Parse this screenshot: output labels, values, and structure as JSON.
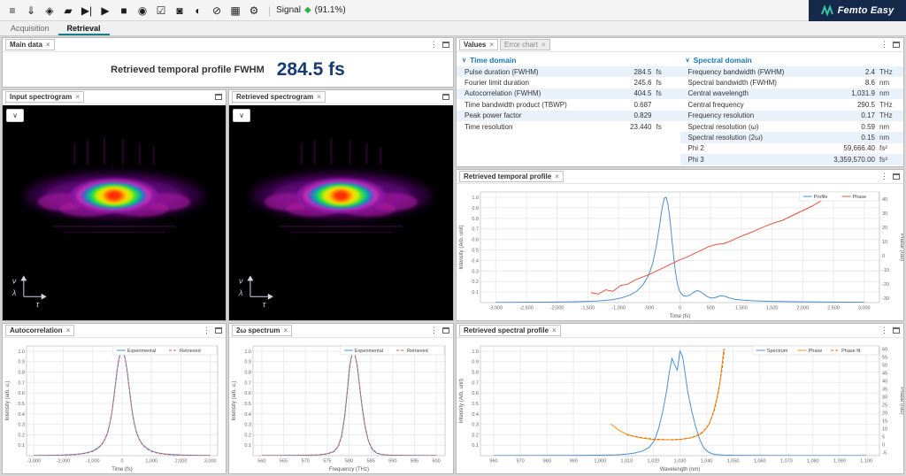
{
  "colors": {
    "accent": "#1779ba",
    "active_tab_underline": "#0f7f8b",
    "big_value": "#173b72",
    "signal_ok": "#2fb344",
    "logo_bg": "#15294b",
    "profile_blue": "#4a90d2",
    "phase_red": "#e2543f",
    "phase_orange": "#ff8c1a"
  },
  "toolbar": {
    "icons": [
      {
        "name": "menu-icon",
        "glyph": "≡"
      },
      {
        "name": "save-icon",
        "glyph": "⇓"
      },
      {
        "name": "tag-icon",
        "glyph": "◈"
      },
      {
        "name": "eraser-icon",
        "glyph": "▰"
      },
      {
        "name": "skip-end-icon",
        "glyph": "▶|"
      },
      {
        "name": "play-icon",
        "glyph": "▶"
      },
      {
        "name": "stop-icon",
        "glyph": "■"
      },
      {
        "name": "camera-icon",
        "glyph": "◉"
      },
      {
        "name": "thumbs-up-icon",
        "glyph": "☑"
      },
      {
        "name": "video-icon",
        "glyph": "◙"
      },
      {
        "name": "contrast-icon",
        "glyph": "◐"
      },
      {
        "name": "cancel-icon",
        "glyph": "⊘"
      },
      {
        "name": "grid-icon",
        "glyph": "▦"
      },
      {
        "name": "settings-icon",
        "glyph": "⚙"
      }
    ],
    "signal_label": "Signal",
    "signal_value": "(91.1%)",
    "logo_title": "Femto Easy"
  },
  "tabs": [
    {
      "label": "Acquisition",
      "active": false
    },
    {
      "label": "Retrieval",
      "active": true
    }
  ],
  "panels": {
    "main_data": {
      "tab": "Main data",
      "label": "Retrieved temporal profile FWHM",
      "value": "284.5 fs"
    },
    "values": {
      "tabs": [
        {
          "label": "Values"
        },
        {
          "label": "Error chart"
        }
      ]
    },
    "input_spectrogram": {
      "tab": "Input spectrogram"
    },
    "retrieved_spectrogram": {
      "tab": "Retrieved spectrogram"
    },
    "temporal_profile": {
      "tab": "Retrieved temporal profile"
    },
    "autocorrelation": {
      "tab": "Autocorrelation"
    },
    "spectrum_2w": {
      "tab": "2ω spectrum"
    },
    "spectral_profile": {
      "tab": "Retrieved spectral profile"
    }
  },
  "values_panel": {
    "sections": [
      {
        "title": "Time domain",
        "rows": [
          [
            "Pulse duration (FWHM)",
            "284.5",
            "fs"
          ],
          [
            "Fourier limit duration",
            "245.6",
            "fs"
          ],
          [
            "Autocorrelation (FWHM)",
            "404.5",
            "fs"
          ],
          [
            "Time bandwidth product (TBWP)",
            "0.687",
            ""
          ],
          [
            "Peak power factor",
            "0.829",
            ""
          ],
          [
            "Time resolution",
            "23.440",
            "fs"
          ]
        ]
      },
      {
        "title": "Spectral domain",
        "rows": [
          [
            "Frequency bandwidth (FWHM)",
            "2.4",
            "THz"
          ],
          [
            "Spectral bandwidth (FWHM)",
            "8.6",
            "nm"
          ],
          [
            "Central wavelength",
            "1,031.9",
            "nm"
          ],
          [
            "Central frequency",
            "290.5",
            "THz"
          ],
          [
            "Frequency resolution",
            "0.17",
            "THz"
          ],
          [
            "Spectral resolution (ω)",
            "0.59",
            "nm"
          ],
          [
            "Spectral resolution (2ω)",
            "0.15",
            "nm"
          ],
          [
            "Phi 2",
            "59,666.40",
            "fs²"
          ],
          [
            "Phi 3",
            "3,359,570.00",
            "fs³"
          ]
        ]
      }
    ]
  },
  "chart_data": {
    "temporal": {
      "type": "line",
      "xlabel": "Time (fs)",
      "ylabel": "Intensity (Arb. unit)",
      "y2label": "Phase (rad)",
      "xlim": [
        -3250,
        3250
      ],
      "ylim": [
        0,
        1.05
      ],
      "y2lim": [
        -33,
        45
      ],
      "ydec": 1,
      "xticks": [
        -3000,
        -2500,
        -2000,
        -1500,
        -1000,
        -500,
        0,
        500,
        1000,
        1500,
        2000,
        2500,
        3000
      ],
      "yticks": [
        0.1,
        0.2,
        0.3,
        0.4,
        0.5,
        0.6,
        0.7,
        0.8,
        0.9,
        1.0
      ],
      "y2ticks": [
        -30,
        -20,
        -10,
        0,
        10,
        20,
        30,
        40
      ],
      "series": [
        {
          "name": "Profile",
          "color": "#4a90d2",
          "axis": "left",
          "x": [
            -3000,
            -2200,
            -1700,
            -1350,
            -1100,
            -950,
            -820,
            -700,
            -600,
            -510,
            -440,
            -380,
            -330,
            -290,
            -255,
            -225,
            -195,
            -165,
            -135,
            -105,
            -75,
            -45,
            -15,
            20,
            60,
            110,
            170,
            230,
            280,
            330,
            390,
            450,
            520,
            590,
            660,
            730,
            800,
            900,
            1050,
            1250,
            1500,
            1900,
            2400,
            3000
          ],
          "y": [
            0.002,
            0.004,
            0.008,
            0.015,
            0.028,
            0.045,
            0.07,
            0.11,
            0.17,
            0.26,
            0.38,
            0.55,
            0.74,
            0.9,
            0.99,
            1.0,
            0.93,
            0.8,
            0.63,
            0.45,
            0.3,
            0.19,
            0.12,
            0.085,
            0.065,
            0.06,
            0.075,
            0.1,
            0.115,
            0.105,
            0.08,
            0.055,
            0.042,
            0.05,
            0.065,
            0.06,
            0.045,
            0.03,
            0.022,
            0.016,
            0.012,
            0.008,
            0.005,
            0.003
          ]
        },
        {
          "name": "Phase",
          "color": "#e2543f",
          "axis": "right",
          "x": [
            -1450,
            -1330,
            -1210,
            -1090,
            -970,
            -850,
            -730,
            -610,
            -490,
            -370,
            -250,
            -130,
            -10,
            110,
            230,
            350,
            470,
            590,
            710,
            830,
            950,
            1070,
            1190,
            1310,
            1430,
            1550,
            1670,
            1790,
            1910,
            2030,
            2150,
            2270,
            2350
          ],
          "y": [
            -26,
            -27,
            -24,
            -25,
            -21,
            -20,
            -17,
            -15,
            -13,
            -10.5,
            -8,
            -5.5,
            -3,
            -1,
            1.5,
            4,
            6.5,
            8,
            8.5,
            10.5,
            13,
            15,
            17,
            19.5,
            21.5,
            23.5,
            25,
            27.5,
            30,
            32.5,
            35,
            38,
            40
          ]
        }
      ]
    },
    "autocorrelation": {
      "type": "line",
      "xlabel": "Time (fs)",
      "ylabel": "Intensity (arb. u.)",
      "xlim": [
        -3250,
        3250
      ],
      "ylim": [
        0,
        1.05
      ],
      "ydec": 1,
      "xticks": [
        -3000,
        -2000,
        -1000,
        0,
        1000,
        2000,
        3000
      ],
      "yticks": [
        0.1,
        0.2,
        0.3,
        0.4,
        0.5,
        0.6,
        0.7,
        0.8,
        0.9,
        1.0
      ],
      "series": [
        {
          "name": "Experimental",
          "color": "#4a90d2",
          "axis": "left",
          "x": [
            -3000,
            -2500,
            -2000,
            -1700,
            -1400,
            -1200,
            -1000,
            -850,
            -700,
            -600,
            -500,
            -420,
            -350,
            -290,
            -230,
            -170,
            -110,
            -60,
            0,
            60,
            110,
            170,
            230,
            290,
            350,
            420,
            500,
            600,
            700,
            850,
            1000,
            1200,
            1400,
            1700,
            2000,
            2500,
            3000
          ],
          "y": [
            0.002,
            0.003,
            0.006,
            0.01,
            0.018,
            0.028,
            0.045,
            0.07,
            0.105,
            0.15,
            0.215,
            0.3,
            0.41,
            0.54,
            0.68,
            0.82,
            0.92,
            0.98,
            1.0,
            0.98,
            0.92,
            0.82,
            0.68,
            0.54,
            0.41,
            0.3,
            0.215,
            0.15,
            0.105,
            0.07,
            0.045,
            0.028,
            0.018,
            0.01,
            0.006,
            0.003,
            0.002
          ]
        },
        {
          "name": "Retrieved",
          "color": "#d9534f",
          "axis": "left",
          "dash": true,
          "x": [
            -3000,
            -2500,
            -2000,
            -1700,
            -1400,
            -1200,
            -1000,
            -850,
            -700,
            -600,
            -500,
            -420,
            -350,
            -290,
            -230,
            -170,
            -110,
            -60,
            0,
            60,
            110,
            170,
            230,
            290,
            350,
            420,
            500,
            600,
            700,
            850,
            1000,
            1200,
            1400,
            1700,
            2000,
            2500,
            3000
          ],
          "y": [
            0.001,
            0.002,
            0.004,
            0.008,
            0.015,
            0.024,
            0.04,
            0.065,
            0.1,
            0.145,
            0.21,
            0.3,
            0.405,
            0.535,
            0.675,
            0.815,
            0.915,
            0.975,
            1.0,
            0.975,
            0.915,
            0.815,
            0.675,
            0.535,
            0.405,
            0.3,
            0.21,
            0.145,
            0.1,
            0.065,
            0.04,
            0.024,
            0.015,
            0.008,
            0.004,
            0.002,
            0.001
          ]
        }
      ]
    },
    "spectrum2w": {
      "type": "line",
      "xlabel": "Frequency (THz)",
      "ylabel": "Intensity (arb. u.)",
      "xlim": [
        558,
        602
      ],
      "ylim": [
        0,
        1.05
      ],
      "ydec": 1,
      "xticks": [
        560,
        565,
        570,
        575,
        580,
        585,
        590,
        595,
        600
      ],
      "yticks": [
        0.1,
        0.2,
        0.3,
        0.4,
        0.5,
        0.6,
        0.7,
        0.8,
        0.9,
        1.0
      ],
      "series": [
        {
          "name": "Experimental",
          "color": "#4a90d2",
          "axis": "left",
          "x": [
            560,
            566,
            570,
            573,
            575,
            576.5,
            577.5,
            578.3,
            579,
            579.6,
            580.1,
            580.6,
            581,
            581.4,
            581.9,
            582.4,
            583,
            583.7,
            584.5,
            585.4,
            586.4,
            587.6,
            589,
            591,
            594,
            600
          ],
          "y": [
            0.001,
            0.002,
            0.004,
            0.008,
            0.018,
            0.04,
            0.09,
            0.19,
            0.38,
            0.62,
            0.84,
            0.96,
            1.0,
            0.96,
            0.85,
            0.67,
            0.46,
            0.27,
            0.13,
            0.055,
            0.022,
            0.01,
            0.005,
            0.003,
            0.002,
            0.001
          ]
        },
        {
          "name": "Retrieved",
          "color": "#d9534f",
          "axis": "left",
          "dash": true,
          "x": [
            560,
            566,
            570,
            573,
            575,
            576.5,
            577.5,
            578.3,
            579,
            579.6,
            580.1,
            580.6,
            581,
            581.4,
            581.9,
            582.4,
            583,
            583.7,
            584.5,
            585.4,
            586.4,
            587.6,
            589,
            591,
            594,
            600
          ],
          "y": [
            0.001,
            0.002,
            0.003,
            0.007,
            0.016,
            0.036,
            0.085,
            0.18,
            0.37,
            0.61,
            0.83,
            0.955,
            1.0,
            0.958,
            0.86,
            0.68,
            0.47,
            0.28,
            0.135,
            0.06,
            0.025,
            0.011,
            0.005,
            0.003,
            0.002,
            0.001
          ]
        }
      ]
    },
    "spectral": {
      "type": "line",
      "xlabel": "Wavelength (nm)",
      "ylabel": "Intensity (Arb. unit)",
      "y2label": "Phase (rad)",
      "xlim": [
        955,
        1105
      ],
      "ylim": [
        0,
        1.05
      ],
      "y2lim": [
        -7,
        62
      ],
      "ydec": 1,
      "xticks": [
        960,
        970,
        980,
        990,
        1000,
        1010,
        1020,
        1030,
        1040,
        1050,
        1060,
        1070,
        1080,
        1090,
        1100
      ],
      "yticks": [
        0.1,
        0.2,
        0.3,
        0.4,
        0.5,
        0.6,
        0.7,
        0.8,
        0.9,
        1.0
      ],
      "y2ticks": [
        -5,
        0,
        5,
        10,
        15,
        20,
        25,
        30,
        35,
        40,
        45,
        50,
        55,
        60
      ],
      "series": [
        {
          "name": "Spectrum",
          "color": "#4a90d2",
          "axis": "left",
          "x": [
            960,
            985,
            1000,
            1006,
            1010,
            1013,
            1016,
            1018.5,
            1020.5,
            1022,
            1023.5,
            1025,
            1026,
            1027,
            1028,
            1029,
            1030,
            1031,
            1032,
            1033,
            1034.5,
            1036,
            1037.5,
            1039,
            1041,
            1043,
            1046,
            1050,
            1060,
            1080,
            1100
          ],
          "y": [
            0.001,
            0.002,
            0.004,
            0.008,
            0.015,
            0.025,
            0.045,
            0.08,
            0.15,
            0.26,
            0.42,
            0.62,
            0.8,
            0.93,
            0.87,
            0.82,
            1.0,
            0.95,
            0.78,
            0.6,
            0.42,
            0.27,
            0.15,
            0.07,
            0.03,
            0.012,
            0.006,
            0.003,
            0.002,
            0.001,
            0.001
          ]
        },
        {
          "name": "Phase",
          "color": "#ff8c1a",
          "axis": "right",
          "x": [
            1004,
            1007,
            1010,
            1013,
            1016,
            1020,
            1024,
            1028,
            1031,
            1034,
            1036,
            1038,
            1039.5,
            1041,
            1042,
            1043,
            1044,
            1045,
            1045.8,
            1046.5
          ],
          "y": [
            13,
            9,
            6.5,
            5,
            4,
            3.2,
            3,
            3,
            3.4,
            4.2,
            5.2,
            7,
            9.5,
            13,
            17.5,
            23,
            30,
            39,
            50,
            60
          ]
        },
        {
          "name": "Phase fit",
          "color": "#e06c00",
          "axis": "right",
          "dash": true,
          "x": [
            1010,
            1015,
            1020,
            1025,
            1030,
            1034,
            1037,
            1039,
            1041,
            1043,
            1044.5,
            1045.8,
            1046.8
          ],
          "y": [
            6,
            4.5,
            3.4,
            3,
            3.2,
            4.2,
            6,
            8.5,
            13,
            22,
            33,
            47,
            60
          ]
        }
      ]
    }
  }
}
